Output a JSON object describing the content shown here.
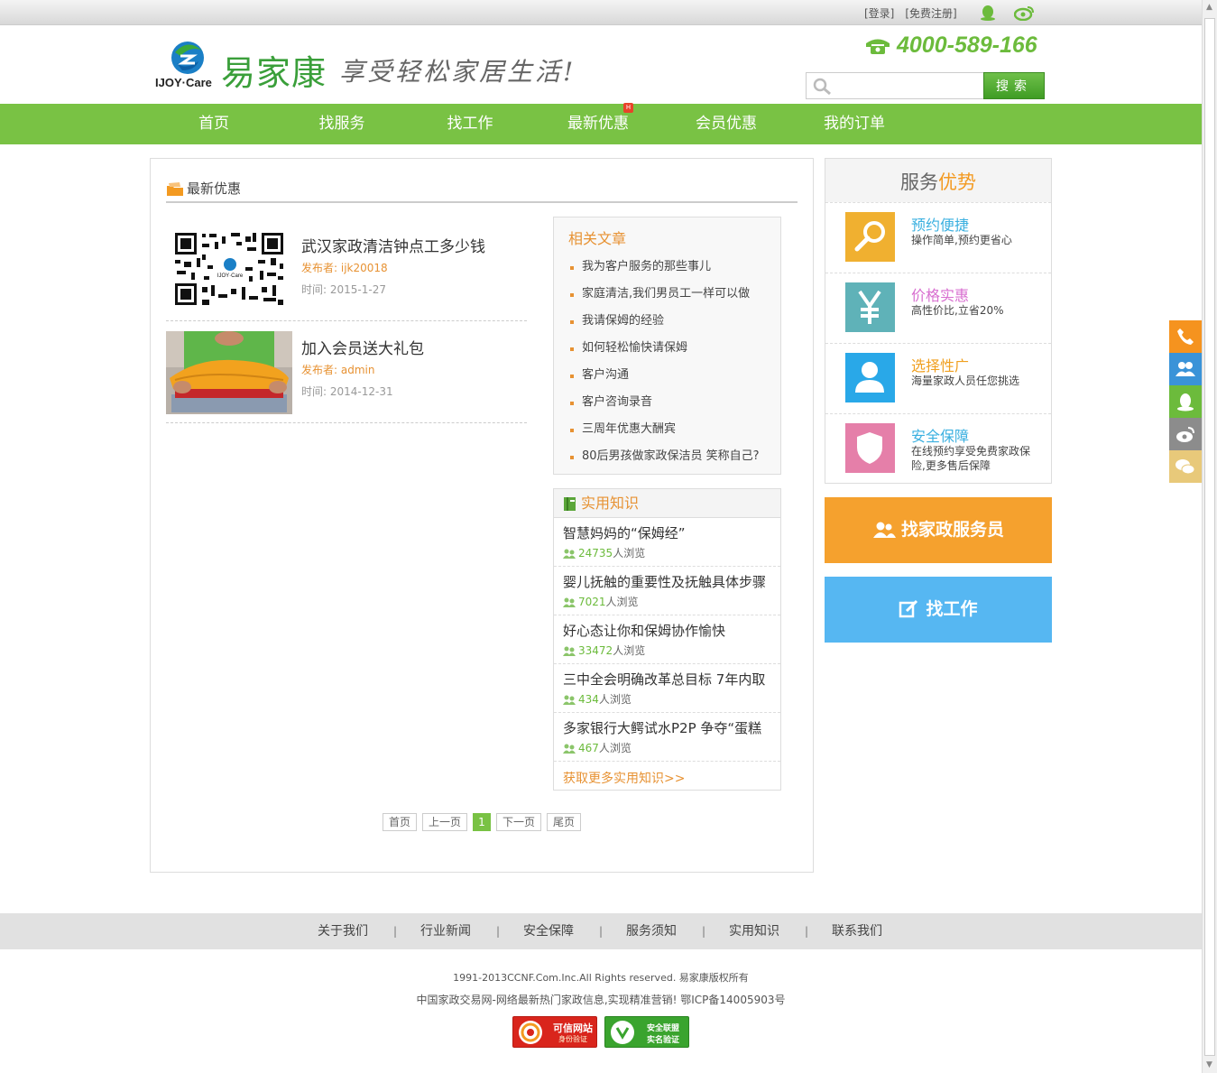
{
  "topbar": {
    "login": "[登录]",
    "register": "[免费注册]"
  },
  "header": {
    "logo_text": "IJOY·Care",
    "brand": "易家康",
    "slogan": "享受轻松家居生活!",
    "phone": "4000-589-166",
    "search_placeholder": "",
    "search_button": "搜索"
  },
  "nav": [
    "首页",
    "找服务",
    "找工作",
    "最新优惠",
    "会员优惠",
    "我的订单"
  ],
  "nav_hot_badge": "H",
  "main": {
    "section_title": "最新优惠",
    "articles": [
      {
        "title": "武汉家政清洁钟点工多少钱",
        "author": "发布者: ijk20018",
        "time": "时间: 2015-1-27"
      },
      {
        "title": "加入会员送大礼包",
        "author": "发布者: admin",
        "time": "时间: 2014-12-31"
      }
    ]
  },
  "related": {
    "title": "相关文章",
    "items": [
      "我为客户服务的那些事儿",
      "家庭清洁,我们男员工一样可以做",
      "我请保姆的经验",
      "如何轻松愉快请保姆",
      "客户沟通",
      "客户咨询录音",
      "三周年优惠大酬宾",
      "80后男孩做家政保洁员 笑称自己?"
    ]
  },
  "knowledge": {
    "title": "实用知识",
    "items": [
      {
        "title": "智慧妈妈的“保姆经”",
        "count": "24735",
        "suffix": "人浏览"
      },
      {
        "title": "婴儿抚触的重要性及抚触具体步骤",
        "count": "7021",
        "suffix": "人浏览"
      },
      {
        "title": "好心态让你和保姆协作愉快",
        "count": "33472",
        "suffix": "人浏览"
      },
      {
        "title": "三中全会明确改革总目标 7年内取",
        "count": "434",
        "suffix": "人浏览"
      },
      {
        "title": "多家银行大鳄试水P2P 争夺“蛋糕",
        "count": "467",
        "suffix": "人浏览"
      }
    ],
    "more": "获取更多实用知识>>"
  },
  "pager": {
    "first": "首页",
    "prev": "上一页",
    "current": "1",
    "next": "下一页",
    "last": "尾页"
  },
  "sidebar": {
    "title_a": "服务",
    "title_b": "优势",
    "advantages": [
      {
        "title": "预约便捷",
        "desc": "操作简单,预约更省心",
        "color": "#3bb0e0",
        "icon_bg": "#f0b030",
        "icon": "search-icon"
      },
      {
        "title": "价格实惠",
        "desc": "高性价比,立省20%",
        "color": "#d86fd0",
        "icon_bg": "#5fb2b8",
        "icon": "yen-icon"
      },
      {
        "title": "选择性广",
        "desc": "海量家政人员任您挑选",
        "color": "#f0a020",
        "icon_bg": "#29a8e8",
        "icon": "person-icon"
      },
      {
        "title": "安全保障",
        "desc": "在线预约享受免费家政保险,更多售后保障",
        "color": "#3bb0e0",
        "icon_bg": "#e57fa9",
        "icon": "shield-icon"
      }
    ],
    "find_service": "找家政服务员",
    "find_job": "找工作"
  },
  "footer": {
    "links": [
      "关于我们",
      "行业新闻",
      "安全保障",
      "服务须知",
      "实用知识",
      "联系我们"
    ],
    "sep": "|",
    "copyright": "1991-2013CCNF.Com.Inc.All Rights reserved. 易家康版权所有",
    "icp": "中国家政交易网-网络最新热门家政信息,实现精准营销! 鄂ICP备14005903号",
    "badge1": "可信网站",
    "badge1_sub": "身份验证",
    "badge2": "安全联盟",
    "badge2_sub": "实名验证"
  },
  "colors": {
    "green": "#79c244",
    "orange": "#f5a12e",
    "blue": "#56b7f2"
  }
}
